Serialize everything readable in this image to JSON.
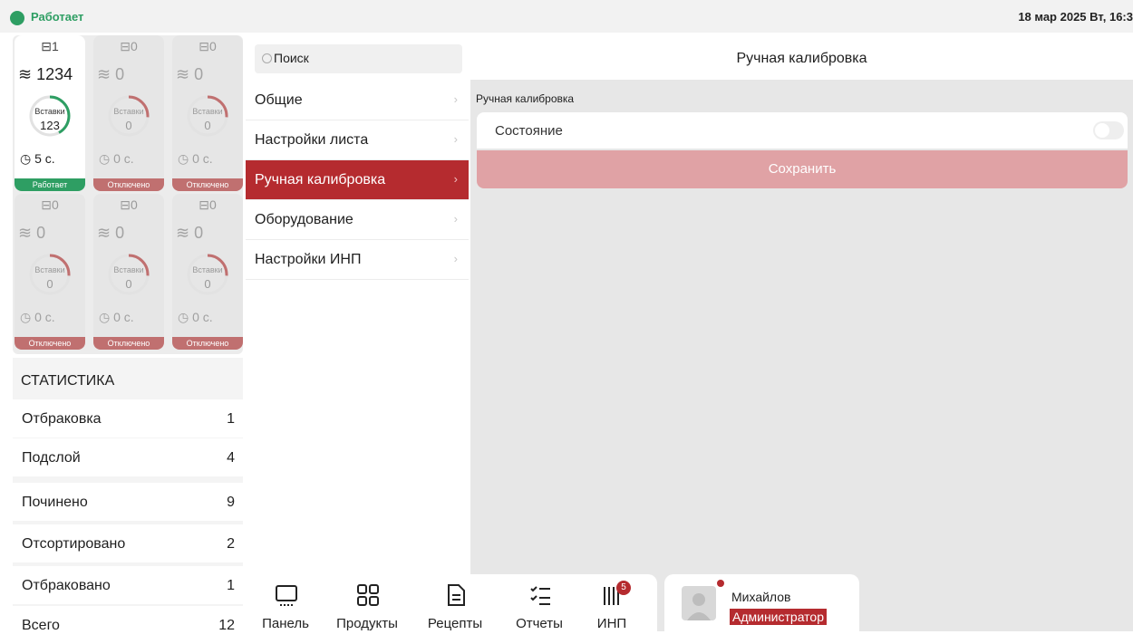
{
  "colors": {
    "accent": "#b52b2f",
    "ok": "#2e9e63",
    "disabled": "#c07070",
    "save_bg": "#e0a2a5"
  },
  "status": {
    "label": "Работает",
    "datetime": "18 мар 2025 Вт, 16:3"
  },
  "tiles": [
    {
      "counter": "1",
      "stack": "1234",
      "gauge_label": "Вставки",
      "gauge_value": "123",
      "timer": "5 с.",
      "state": "Работает",
      "active": true
    },
    {
      "counter": "0",
      "stack": "0",
      "gauge_label": "Вставки",
      "gauge_value": "0",
      "timer": "0 с.",
      "state": "Отключено",
      "active": false
    },
    {
      "counter": "0",
      "stack": "0",
      "gauge_label": "Вставки",
      "gauge_value": "0",
      "timer": "0 с.",
      "state": "Отключено",
      "active": false
    },
    {
      "counter": "0",
      "stack": "0",
      "gauge_label": "Вставки",
      "gauge_value": "0",
      "timer": "0 с.",
      "state": "Отключено",
      "active": false
    },
    {
      "counter": "0",
      "stack": "0",
      "gauge_label": "Вставки",
      "gauge_value": "0",
      "timer": "0 с.",
      "state": "Отключено",
      "active": false
    },
    {
      "counter": "0",
      "stack": "0",
      "gauge_label": "Вставки",
      "gauge_value": "0",
      "timer": "0 с.",
      "state": "Отключено",
      "active": false
    }
  ],
  "stats": {
    "title": "СТАТИСТИКА",
    "rows": [
      {
        "label": "Отбраковка",
        "value": "1"
      },
      {
        "label": "Подслой",
        "value": "4"
      },
      {
        "label": "Починено",
        "value": "9"
      },
      {
        "label": "Отсортировано",
        "value": "2"
      },
      {
        "label": "Отбраковано",
        "value": "1"
      },
      {
        "label": "Всего",
        "value": "12"
      }
    ]
  },
  "menu": {
    "search_placeholder": "Поиск",
    "items": [
      {
        "label": "Общие"
      },
      {
        "label": "Настройки листа"
      },
      {
        "label": "Ручная калибровка"
      },
      {
        "label": "Оборудование"
      },
      {
        "label": "Настройки ИНП"
      }
    ]
  },
  "detail": {
    "title": "Ручная калибровка",
    "section": "Ручная калибровка",
    "state_label": "Состояние",
    "save_label": "Сохранить"
  },
  "nav": {
    "items": [
      {
        "label": "Панель",
        "icon": "monitor-icon"
      },
      {
        "label": "Продукты",
        "icon": "grid-icon"
      },
      {
        "label": "Рецепты",
        "icon": "document-icon"
      },
      {
        "label": "Отчеты",
        "icon": "checklist-icon"
      },
      {
        "label": "ИНП",
        "icon": "barcode-icon",
        "badge": "5"
      }
    ]
  },
  "user": {
    "name": "Михайлов",
    "role": "Администратор"
  }
}
